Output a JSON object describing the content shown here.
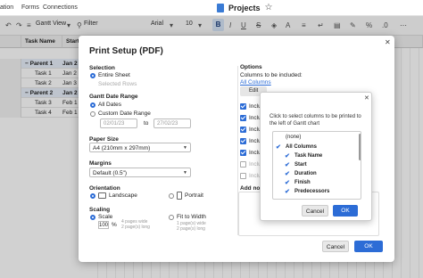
{
  "topbar": {
    "menus": [
      "ation",
      "Forms",
      "Connections"
    ],
    "doc_title": "Projects"
  },
  "toolbar": {
    "view": "Gantt View",
    "filter": "Filter",
    "font": "Arial",
    "size": "10",
    "bold": "B"
  },
  "sheet": {
    "columns": [
      "Task Name",
      "Start"
    ],
    "rows": [
      {
        "name": "Parent 1",
        "start": "Jan 2",
        "kind": "parent"
      },
      {
        "name": "Task 1",
        "start": "Jan 2",
        "kind": "task"
      },
      {
        "name": "Task 2",
        "start": "Jan 3",
        "kind": "task"
      },
      {
        "name": "Parent 2",
        "start": "Jan 2",
        "kind": "parent"
      },
      {
        "name": "Task 3",
        "start": "Feb 1",
        "kind": "task"
      },
      {
        "name": "Task 4",
        "start": "Feb 1",
        "kind": "task"
      }
    ]
  },
  "dialog": {
    "title": "Print Setup (PDF)",
    "selection": {
      "label": "Selection",
      "entire_sheet": "Entire Sheet",
      "selected_rows": "Selected Rows"
    },
    "gantt_range": {
      "label": "Gantt Date Range",
      "all_dates": "All Dates",
      "custom": "Custom Date Range",
      "from": "02/01/23",
      "to_label": "to",
      "to": "27/02/23"
    },
    "paper": {
      "label": "Paper Size",
      "value": "A4 (210mm x 297mm)"
    },
    "margins": {
      "label": "Margins",
      "value": "Default (0.5\")"
    },
    "orientation": {
      "label": "Orientation",
      "landscape": "Landscape",
      "portrait": "Portrait"
    },
    "scaling": {
      "label": "Scaling",
      "scale": "Scale",
      "scale_value": "100",
      "scale_hint1": "4 pages wide",
      "scale_hint2": "2 page(s) long",
      "fit_to_width": "Fit to Width",
      "fit_hint1": "1 page(s) wide",
      "fit_hint2": "2 page(s) long"
    },
    "options": {
      "label": "Options",
      "columns_included": "Columns to be included:",
      "all_columns": "All Columns",
      "edit": "Edit",
      "include_items": [
        "Inclu",
        "Inclu",
        "Inclu",
        "Inclu",
        "Inclu",
        "Inclu",
        "Inclu"
      ],
      "add_notes": "Add not"
    },
    "cancel": "Cancel",
    "ok": "OK"
  },
  "popover": {
    "description": "Click to select columns to be printed to the left of Gantt chart",
    "items": [
      {
        "label": "(none)",
        "checked": false
      },
      {
        "label": "All Columns",
        "checked": true
      },
      {
        "label": "Task Name",
        "checked": true
      },
      {
        "label": "Start",
        "checked": true
      },
      {
        "label": "Duration",
        "checked": true
      },
      {
        "label": "Finish",
        "checked": true
      },
      {
        "label": "Predecessors",
        "checked": true
      }
    ],
    "cancel": "Cancel",
    "ok": "OK"
  },
  "colors": {
    "accent": "#2c6cd6",
    "parent_row": "#e8f0fb"
  }
}
